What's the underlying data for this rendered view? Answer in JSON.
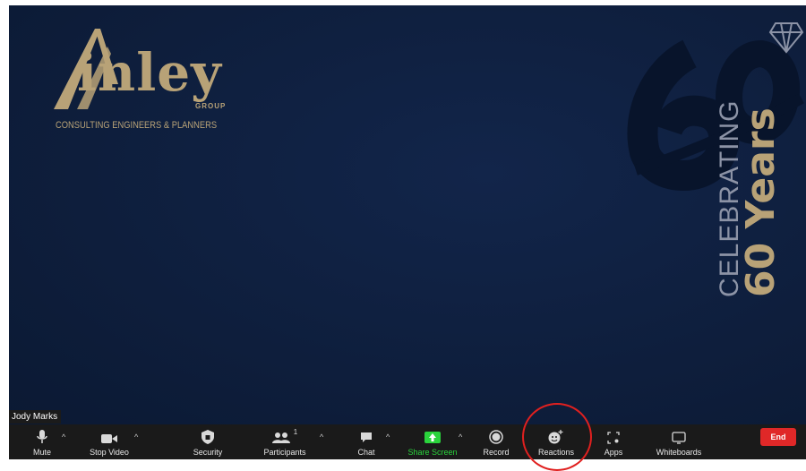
{
  "meeting": {
    "participant_name": "Jody Marks",
    "background": {
      "logo_word": "inley",
      "logo_group": "GROUP",
      "logo_tagline": "CONSULTING ENGINEERS & PLANNERS",
      "celebrating": "CELEBRATING",
      "years": "60 Years"
    }
  },
  "toolbar": {
    "mute": "Mute",
    "stop_video": "Stop Video",
    "security": "Security",
    "participants": "Participants",
    "participants_count": "1",
    "chat": "Chat",
    "share_screen": "Share Screen",
    "record": "Record",
    "reactions": "Reactions",
    "apps": "Apps",
    "whiteboards": "Whiteboards",
    "end": "End"
  },
  "colors": {
    "brand_gold": "#b8a277",
    "navy": "#0f1f3d",
    "share_green": "#2ad33c",
    "end_red": "#e02828",
    "highlight_red": "#e0201f"
  }
}
